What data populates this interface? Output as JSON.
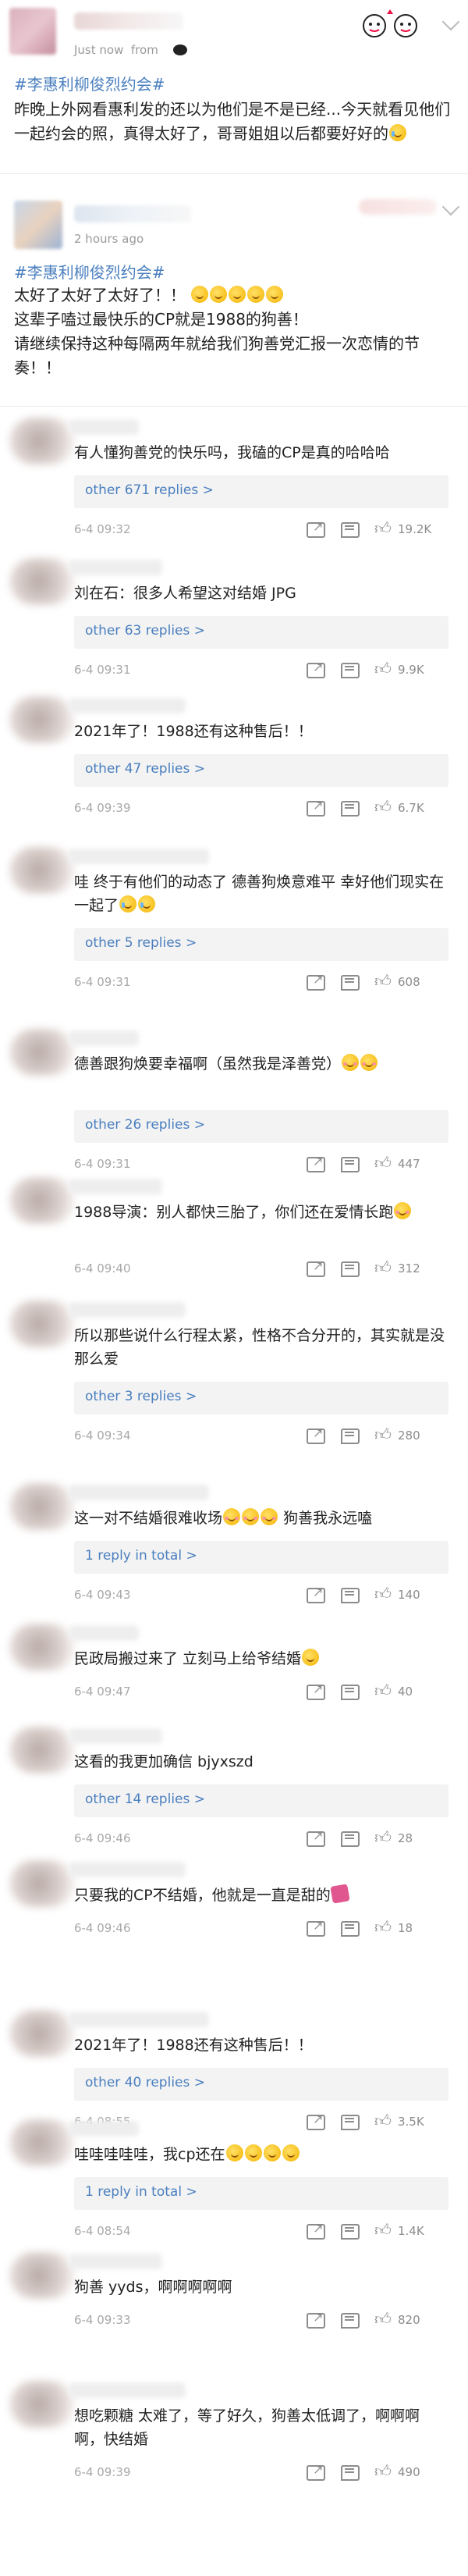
{
  "post1": {
    "meta_time": "Just now",
    "meta_from": "from",
    "topic": "#李惠利柳俊烈约会#",
    "text": "昨晚上外网看惠利发的还以为他们是不是已经...今天就看见他们一起约会的照，真得太好了，哥哥姐姐以后都要好好的"
  },
  "post2": {
    "meta_time": "2 hours ago",
    "topic": "#李惠利柳俊烈约会#",
    "line1": "太好了太好了太好了！！",
    "line2": "这辈子嗑过最快乐的CP就是1988的狗善！",
    "line3": "请继续保持这种每隔两年就给我们狗善党汇报一次恋情的节奏！！"
  },
  "comments": [
    {
      "text": "有人懂狗善党的快乐吗，我磕的CP是真的哈哈哈",
      "replies": "other 671 replies >",
      "time": "6-4 09:32",
      "likes": "19.2K"
    },
    {
      "text": "刘在石：很多人希望这对结婚  JPG",
      "replies": "other 63 replies >",
      "time": "6-4 09:31",
      "likes": "9.9K"
    },
    {
      "text": "2021年了！1988还有这种售后！！",
      "replies": "other 47 replies >",
      "time": "6-4 09:39",
      "likes": "6.7K"
    },
    {
      "text": "哇  终于有他们的动态了  德善狗焕意难平  幸好他们现实在一起了",
      "replies": "other 5 replies >",
      "time": "6-4 09:31",
      "likes": "608"
    },
    {
      "text": "德善跟狗焕要幸福啊（虽然我是泽善党）",
      "replies": "other 26 replies >",
      "time": "6-4 09:31",
      "likes": "447"
    },
    {
      "text": "1988导演：别人都快三胎了，你们还在爱情长跑",
      "replies": "",
      "time": "6-4 09:40",
      "likes": "312"
    },
    {
      "text": "所以那些说什么行程太紧，性格不合分开的，其实就是没那么爱",
      "replies": "other 3 replies >",
      "time": "6-4 09:34",
      "likes": "280"
    },
    {
      "text": "这一对不结婚很难收场",
      "text_tail": "狗善我永远嗑",
      "replies": "1 reply in total >",
      "time": "6-4 09:43",
      "likes": "140"
    },
    {
      "text": "民政局搬过来了 立刻马上给爷结婚",
      "replies": "",
      "time": "6-4 09:47",
      "likes": "40"
    },
    {
      "text": "这看的我更加确信 bjyxszd",
      "replies": "other 14 replies >",
      "time": "6-4 09:46",
      "likes": "28"
    },
    {
      "text": "只要我的CP不结婚，他就是一直是甜的",
      "replies": "",
      "time": "6-4 09:46",
      "likes": "18"
    },
    {
      "text": "2021年了！1988还有这种售后！！",
      "replies": "other 40 replies >",
      "time": "6-4 08:55",
      "likes": "3.5K"
    },
    {
      "text": "哇哇哇哇哇，我cp还在",
      "replies": "1 reply in total >",
      "time": "6-4 08:54",
      "likes": "1.4K"
    },
    {
      "text": "狗善 yyds，啊啊啊啊啊",
      "replies": "",
      "time": "6-4 09:33",
      "likes": "820"
    },
    {
      "text": "想吃颗糖 太难了，等了好久，狗善太低调了，啊啊啊啊，快结婚",
      "replies": "",
      "time": "6-4 09:39",
      "likes": "490"
    }
  ],
  "icons": {
    "share": "share-icon",
    "comment": "comment-icon",
    "like": "like-icon"
  }
}
